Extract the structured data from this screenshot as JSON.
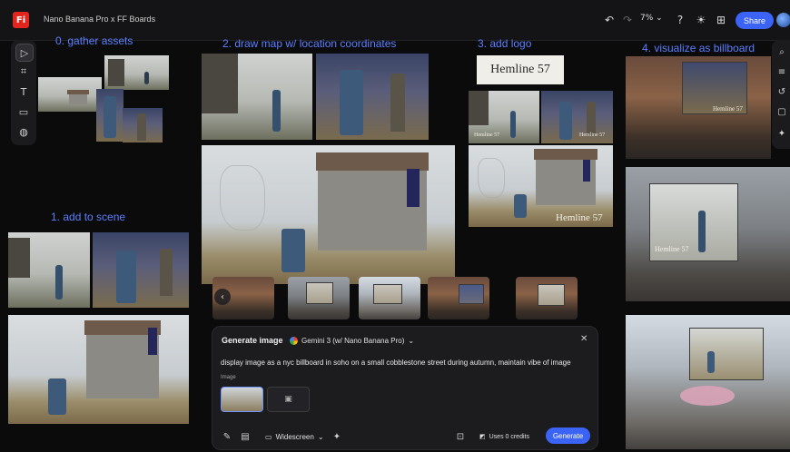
{
  "app": {
    "logo_text": "Fi",
    "title": "Nano Banana Pro x FF Boards"
  },
  "topbar": {
    "undo_icon": "undo-icon",
    "redo_icon": "redo-icon",
    "zoom_value": "7% ⌄",
    "share_label": "Share"
  },
  "labels": {
    "gather": "0.  gather assets",
    "map": "2. draw map w/ location coordinates",
    "logo": "3. add logo",
    "billboard": "4. visualize as billboard",
    "scene": "1.  add to scene"
  },
  "logo_card": {
    "text": "Hemline 57"
  },
  "watermark": {
    "text": "Hemline 57"
  },
  "panel": {
    "title": "Generate image",
    "model": "Gemini 3 (w/ Nano Banana Pro)",
    "prompt": "display image as a nyc billboard in soho on a small cobblestone street during autumn, maintain vibe of image",
    "image_label": "Image",
    "ratio": "Widescreen",
    "credits": "Uses 0 credits",
    "generate_label": "Generate"
  },
  "colors": {
    "accent": "#3b63f5",
    "annotation": "#5b7fff",
    "brand_red": "#e3261d"
  }
}
